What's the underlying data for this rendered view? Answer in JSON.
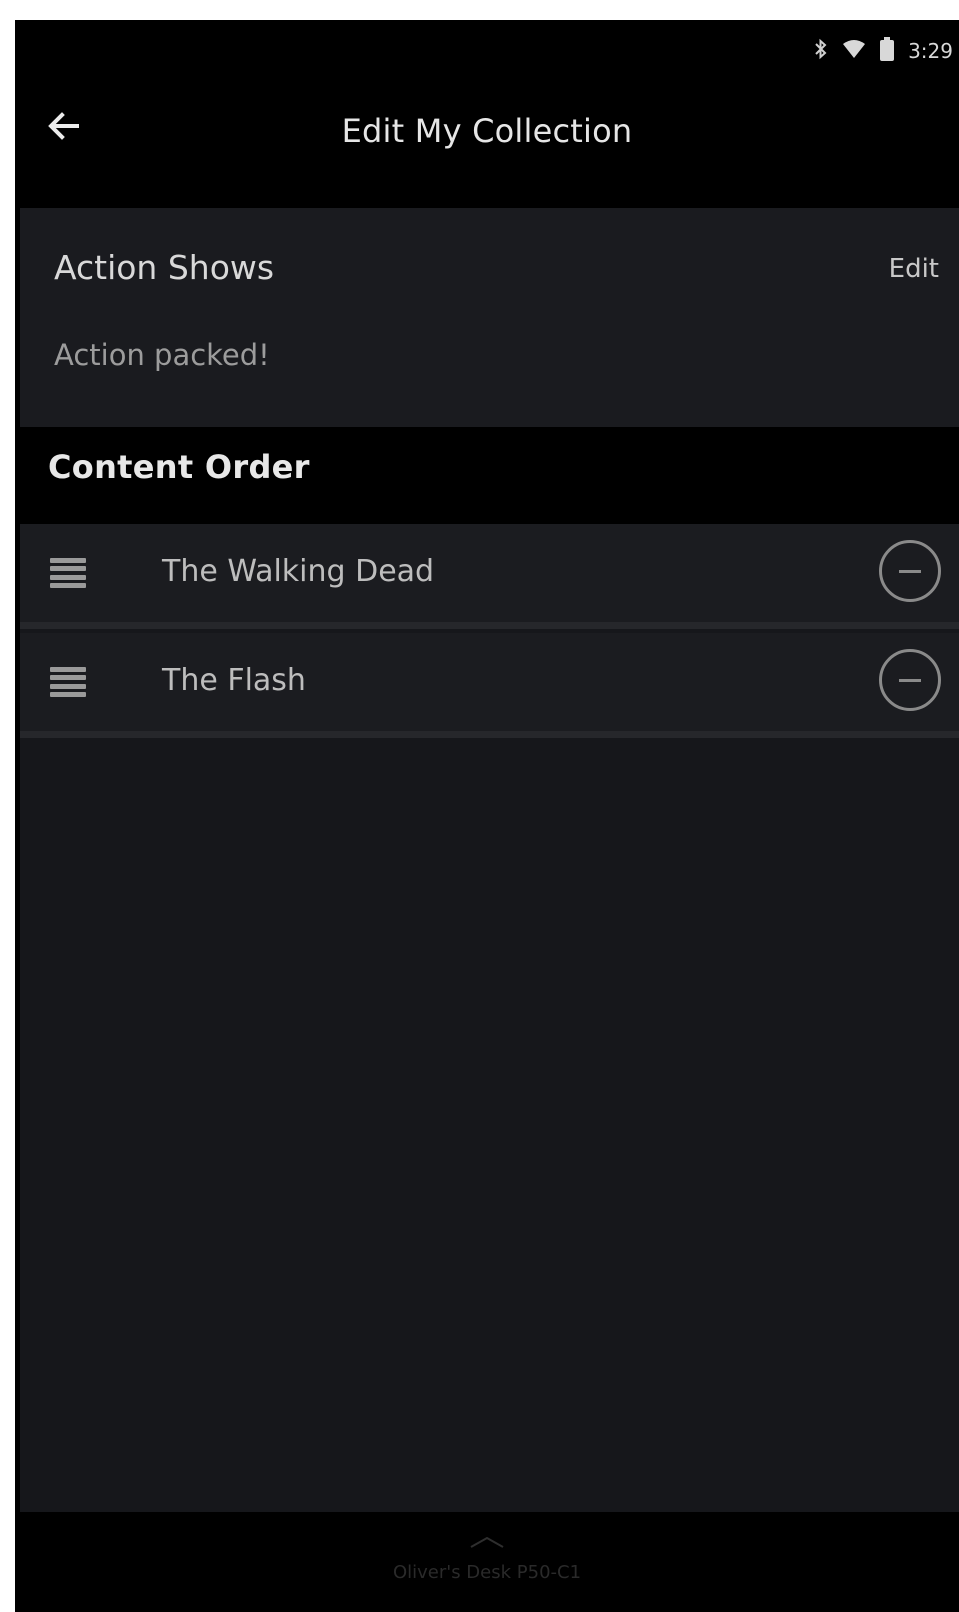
{
  "status_bar": {
    "time": "3:29",
    "icons": [
      "bluetooth-icon",
      "wifi-icon",
      "battery-icon"
    ]
  },
  "app_bar": {
    "back_icon": "arrow-left-icon",
    "title": "Edit My Collection"
  },
  "collection": {
    "name": "Action Shows",
    "edit_label": "Edit",
    "description": "Action packed!"
  },
  "content_order": {
    "header": "Content Order",
    "items": [
      {
        "title": "The Walking Dead"
      },
      {
        "title": "The Flash"
      }
    ]
  },
  "bottom_bar": {
    "device_name": "Oliver's Desk P50-C1",
    "chevron_icon": "chevron-up-icon"
  },
  "colors": {
    "background": "#000000",
    "card": "#1a1b1f",
    "content_area": "#16171b",
    "text_primary": "#e6e6e6",
    "text_secondary": "#9c9c9c"
  }
}
